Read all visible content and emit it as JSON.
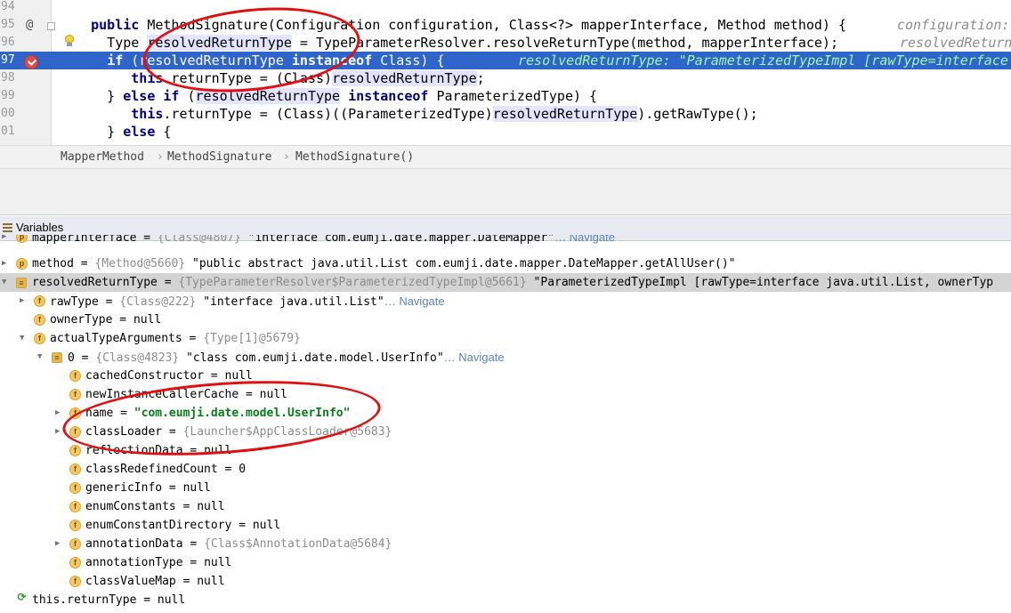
{
  "editor": {
    "lines": [
      {
        "num": "94",
        "segments": []
      },
      {
        "num": "95",
        "segments": [
          {
            "t": "    "
          },
          {
            "t": "public ",
            "c": "kw"
          },
          {
            "t": "MethodSignature(Configuration configuration, Class<?> mapperInterface, Method method) {"
          }
        ],
        "hint": "configuration: "
      },
      {
        "num": "96",
        "segments": [
          {
            "t": "      Type "
          },
          {
            "t": "resolvedReturnType",
            "c": "hl"
          },
          {
            "t": " = TypeParameterResolver.resolveReturnType(method, mapperInterface);"
          }
        ],
        "hint": "resolvedReturn"
      },
      {
        "num": "97",
        "segments": [
          {
            "t": "      "
          },
          {
            "t": "if ",
            "c": "kw"
          },
          {
            "t": "(resolvedReturnType "
          },
          {
            "t": "instanceof ",
            "c": "kw"
          },
          {
            "t": "Class) {"
          }
        ],
        "hint": "resolvedReturnType: \"ParameterizedTypeImpl [rawType=interface"
      },
      {
        "num": "98",
        "segments": [
          {
            "t": "         "
          },
          {
            "t": "this",
            "c": "kw"
          },
          {
            "t": ".returnType = (Class)"
          },
          {
            "t": "resolvedReturnType",
            "c": "hl"
          },
          {
            "t": ";"
          }
        ]
      },
      {
        "num": "99",
        "segments": [
          {
            "t": "      } "
          },
          {
            "t": "else if ",
            "c": "kw"
          },
          {
            "t": "("
          },
          {
            "t": "resolvedReturnType",
            "c": "hl"
          },
          {
            "t": " "
          },
          {
            "t": "instanceof ",
            "c": "kw"
          },
          {
            "t": "ParameterizedType) {"
          }
        ]
      },
      {
        "num": "00",
        "segments": [
          {
            "t": "         "
          },
          {
            "t": "this",
            "c": "kw"
          },
          {
            "t": ".returnType = (Class)((ParameterizedType)"
          },
          {
            "t": "resolvedReturnType",
            "c": "hl"
          },
          {
            "t": ").getRawType();"
          }
        ]
      },
      {
        "num": "01",
        "segments": [
          {
            "t": "      } "
          },
          {
            "t": "else ",
            "c": "kw"
          },
          {
            "t": "{"
          }
        ]
      }
    ]
  },
  "breadcrumb": [
    "MapperMethod",
    "MethodSignature",
    "MethodSignature()"
  ],
  "variables": {
    "title": "Variables",
    "rows": [
      {
        "level": 0,
        "arrow": "▶",
        "badge": "p",
        "name": "mapperInterface",
        "eq": " = ",
        "ref": "{Class@4807} ",
        "value": "\"interface com.eumji.date.mapper.DateMapper\"",
        "nav": "… Navigate",
        "partial": true
      },
      {
        "level": 0,
        "arrow": "▶",
        "badge": "p",
        "name": "method",
        "eq": " = ",
        "ref": "{Method@5660} ",
        "value": "\"public abstract java.util.List com.eumji.date.mapper.DateMapper.getAllUser()\""
      },
      {
        "level": 0,
        "arrow": "▼",
        "badge": "arr",
        "name": "resolvedReturnType",
        "eq": " = ",
        "ref": "{TypeParameterResolver$ParameterizedTypeImpl@5661} ",
        "value": "\"ParameterizedTypeImpl [rawType=interface java.util.List, ownerTyp",
        "selected": true
      },
      {
        "level": 1,
        "arrow": "▶",
        "badge": "f",
        "name": "rawType",
        "eq": " = ",
        "ref": "{Class@222} ",
        "value": "\"interface java.util.List\"",
        "nav": "… Navigate"
      },
      {
        "level": 1,
        "arrow": "",
        "badge": "f",
        "name": "ownerType",
        "eq": " = ",
        "value": "null"
      },
      {
        "level": 1,
        "arrow": "▼",
        "badge": "f",
        "name": "actualTypeArguments",
        "eq": " = ",
        "ref": "{Type[1]@5679}"
      },
      {
        "level": 2,
        "arrow": "▼",
        "badge": "arr",
        "name": "0",
        "eq": " = ",
        "ref": "{Class@4823} ",
        "value": "\"class com.eumji.date.model.UserInfo\"",
        "nav": "… Navigate"
      },
      {
        "level": 3,
        "arrow": "",
        "badge": "f",
        "name": "cachedConstructor",
        "eq": " = ",
        "value": "null"
      },
      {
        "level": 3,
        "arrow": "",
        "badge": "f",
        "name": "newInstanceCallerCache",
        "eq": " = ",
        "value": "null"
      },
      {
        "level": 3,
        "arrow": "▶",
        "badge": "f",
        "name": "name",
        "eq": " = ",
        "value": "\"com.eumji.date.model.UserInfo\"",
        "green": true
      },
      {
        "level": 3,
        "arrow": "▶",
        "badge": "f",
        "name": "classLoader",
        "eq": " = ",
        "ref": "{Launcher$AppClassLoader@5683}"
      },
      {
        "level": 3,
        "arrow": "",
        "badge": "f",
        "name": "reflectionData",
        "eq": " = ",
        "value": "null"
      },
      {
        "level": 3,
        "arrow": "",
        "badge": "f",
        "name": "classRedefinedCount",
        "eq": " = ",
        "value": "0"
      },
      {
        "level": 3,
        "arrow": "",
        "badge": "f",
        "name": "genericInfo",
        "eq": " = ",
        "value": "null"
      },
      {
        "level": 3,
        "arrow": "",
        "badge": "f",
        "name": "enumConstants",
        "eq": " = ",
        "value": "null"
      },
      {
        "level": 3,
        "arrow": "",
        "badge": "f",
        "name": "enumConstantDirectory",
        "eq": " = ",
        "value": "null"
      },
      {
        "level": 3,
        "arrow": "▶",
        "badge": "f",
        "name": "annotationData",
        "eq": " = ",
        "ref": "{Class$AnnotationData@5684}"
      },
      {
        "level": 3,
        "arrow": "",
        "badge": "f",
        "name": "annotationType",
        "eq": " = ",
        "value": "null"
      },
      {
        "level": 3,
        "arrow": "",
        "badge": "f",
        "name": "classValueMap",
        "eq": " = ",
        "value": "null"
      },
      {
        "level": 0,
        "arrow": "",
        "badge": "watch",
        "name": "this.returnType",
        "eq": " = ",
        "value": "null"
      }
    ]
  },
  "colors": {
    "execution_line": "#2f65ca",
    "annotation": "#e01010",
    "string_green": "#067d17"
  }
}
